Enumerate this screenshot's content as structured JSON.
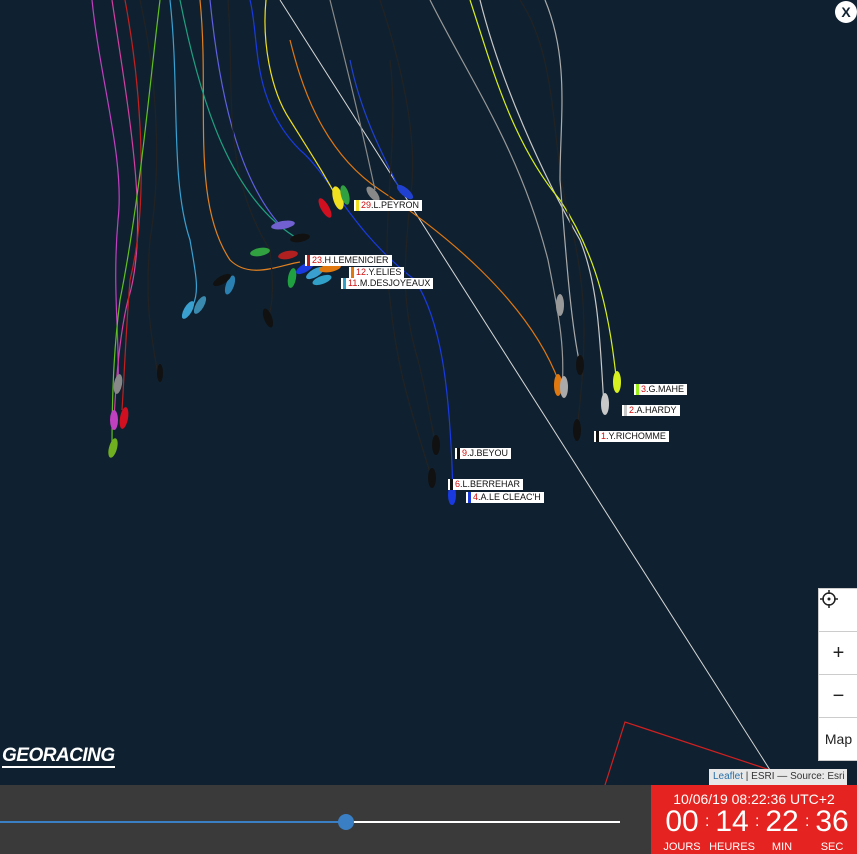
{
  "map": {
    "close_label": "X",
    "boats": [
      {
        "rank": "29",
        "name": "L.PEYRON",
        "color": "#f0e020"
      },
      {
        "rank": "23",
        "name": "H.LEMENICIER",
        "color": "#b02020"
      },
      {
        "rank": "12",
        "name": "Y.ELIES",
        "color": "#e07810"
      },
      {
        "rank": "11",
        "name": "M.DESJOYEAUX",
        "color": "#30a0c8"
      },
      {
        "rank": "3",
        "name": "G.MAHE",
        "color": "#9ef01a"
      },
      {
        "rank": "2",
        "name": "A.HARDY",
        "color": "#c8c8c8"
      },
      {
        "rank": "1",
        "name": "Y.RICHOMME",
        "color": "#101010"
      },
      {
        "rank": "9",
        "name": "J.BEYOU",
        "color": "#101010"
      },
      {
        "rank": "6",
        "name": "L.BERREHAR",
        "color": "#101010"
      },
      {
        "rank": "4",
        "name": "A.LE CLEAC'H",
        "color": "#1a3ae0"
      }
    ],
    "controls": {
      "locate_icon": "crosshair-icon",
      "zoom_in": "+",
      "zoom_out": "−",
      "layer": "Map"
    },
    "attribution": {
      "leaflet": "Leaflet",
      "rest": " | ESRI — Source: Esri"
    },
    "logo": "GEORACING"
  },
  "timeline": {
    "progress": 0.558,
    "datetime": "10/06/19 08:22:36 UTC+2",
    "countdown": {
      "days": "00",
      "hours": "14",
      "minutes": "22",
      "seconds": "36"
    },
    "units": {
      "days": "JOURS",
      "hours": "HEURES",
      "minutes": "MIN",
      "seconds": "SEC"
    }
  }
}
